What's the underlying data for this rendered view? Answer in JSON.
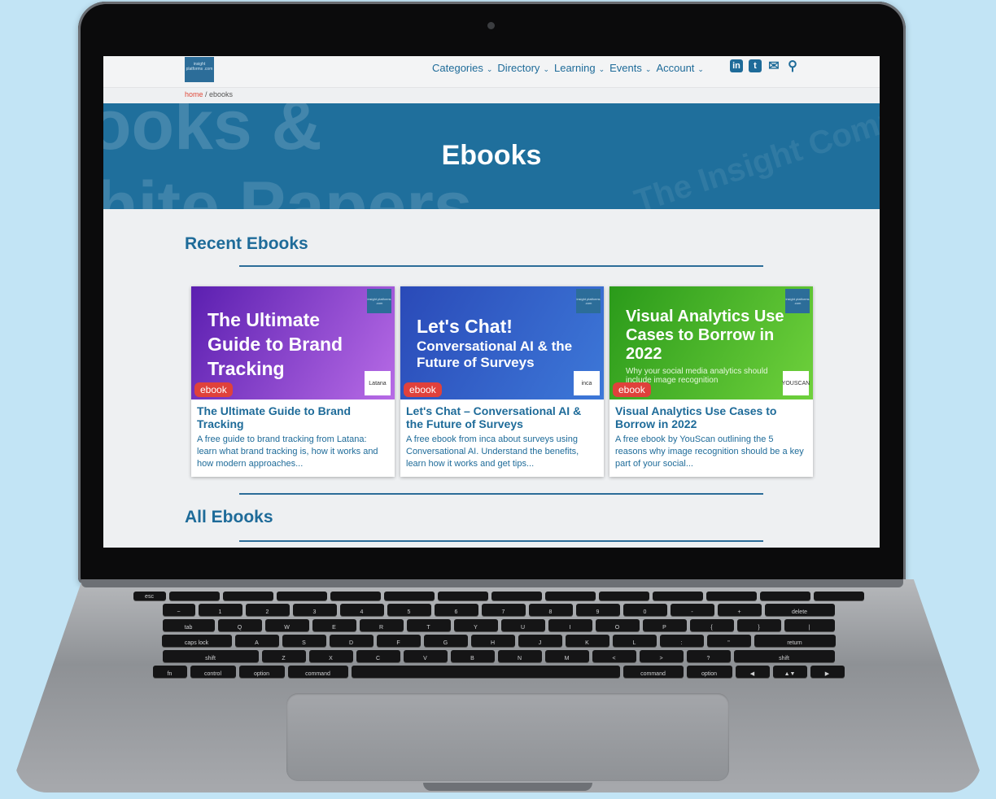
{
  "header": {
    "logo_text": "insight platforms .com",
    "nav": [
      {
        "label": "Categories"
      },
      {
        "label": "Directory"
      },
      {
        "label": "Learning"
      },
      {
        "label": "Events"
      },
      {
        "label": "Account"
      }
    ],
    "social": [
      {
        "icon": "linkedin-icon",
        "glyph": "in"
      },
      {
        "icon": "twitter-icon",
        "glyph": "t"
      },
      {
        "icon": "mail-icon",
        "glyph": "✉"
      },
      {
        "icon": "search-icon",
        "glyph": "⚲"
      }
    ]
  },
  "breadcrumb": {
    "home": "home",
    "separator": " / ",
    "current": "ebooks"
  },
  "hero": {
    "title": "Ebooks",
    "watermark_line1": "ooks &",
    "watermark_line2": "hite Papers",
    "watermark_line3": "The Insight Communities Book"
  },
  "recent": {
    "title": "Recent Ebooks",
    "cards": [
      {
        "image_title": "The Ultimate Guide to Brand Tracking",
        "image_subtitle": "",
        "brand": "Latana",
        "badge": "ebook",
        "title": "The Ultimate Guide to Brand Tracking",
        "description": "A free guide to brand tracking from Latana: learn what brand tracking is, how it works and how modern approaches...",
        "colors": [
          "#5b1fb0",
          "#b76be6"
        ]
      },
      {
        "image_title": "Let's Chat!",
        "image_subtitle": "Conversational AI & the Future of Surveys",
        "brand": "inca",
        "badge": "ebook",
        "title": "Let's Chat – Conversational AI & the Future of Surveys",
        "description": "A free ebook from inca about surveys using Conversational AI. Understand the benefits, learn how it works and get tips...",
        "colors": [
          "#2a4ab8",
          "#3d78d8"
        ]
      },
      {
        "image_title": "Visual Analytics Use Cases to Borrow in 2022",
        "image_subtitle": "Why your social media analytics should include image recognition",
        "brand": "YOUSCAN",
        "badge": "ebook",
        "title": "Visual Analytics Use Cases to Borrow in 2022",
        "description": "A free ebook by YouScan outlining the 5 reasons why image recognition should be a key part of your social...",
        "colors": [
          "#2a9a1a",
          "#6fd13c"
        ]
      }
    ]
  },
  "all": {
    "title": "All Ebooks"
  },
  "keyboard": {
    "rows": [
      [
        "esc",
        "",
        "",
        "",
        "",
        "",
        "",
        "",
        "",
        "",
        "",
        "",
        "",
        ""
      ],
      [
        "~",
        "1",
        "2",
        "3",
        "4",
        "5",
        "6",
        "7",
        "8",
        "9",
        "0",
        "-",
        "+",
        "delete"
      ],
      [
        "tab",
        "Q",
        "W",
        "E",
        "R",
        "T",
        "Y",
        "U",
        "I",
        "O",
        "P",
        "{",
        "}",
        "|"
      ],
      [
        "caps lock",
        "A",
        "S",
        "D",
        "F",
        "G",
        "H",
        "J",
        "K",
        "L",
        ":",
        "\"",
        "return"
      ],
      [
        "shift",
        "Z",
        "X",
        "C",
        "V",
        "B",
        "N",
        "M",
        "<",
        ">",
        "?",
        "shift"
      ],
      [
        "fn",
        "control",
        "option",
        "command",
        "",
        "command",
        "option",
        "◀",
        "▲▼",
        "▶"
      ]
    ]
  }
}
